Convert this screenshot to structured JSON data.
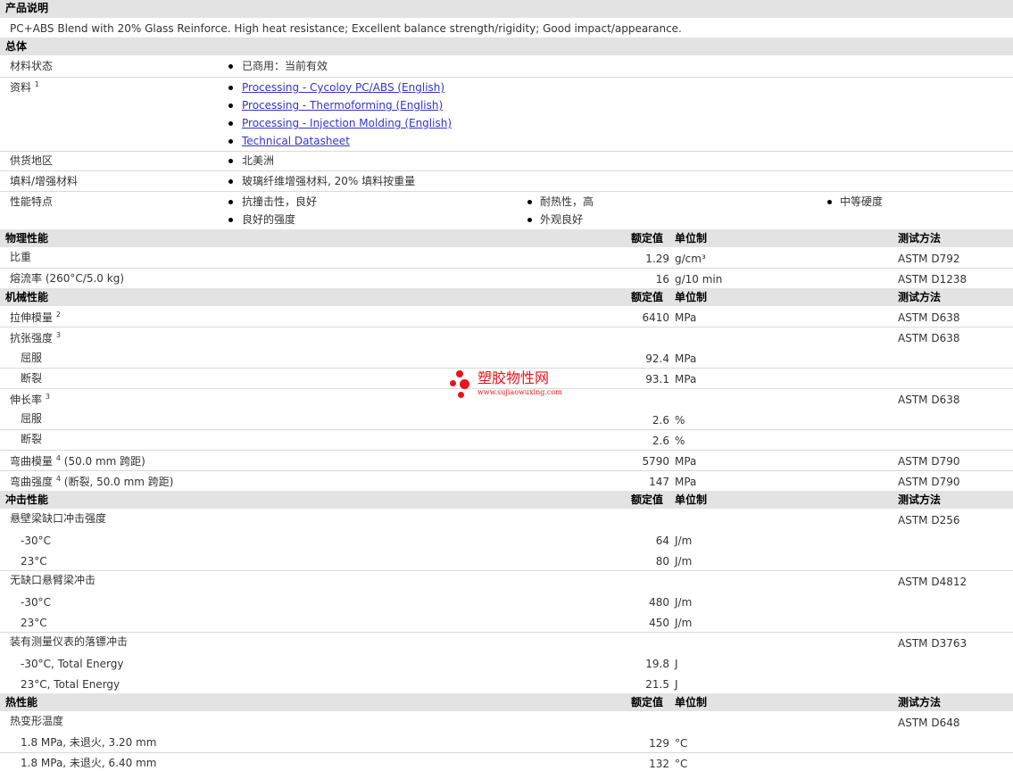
{
  "desc": {
    "header": "产品说明",
    "text": "PC+ABS Blend with 20% Glass Reinforce. High heat resistance; Excellent balance strength/rigidity; Good impact/appearance."
  },
  "general": {
    "header": "总体",
    "status_label": "材料状态",
    "status_value": "已商用：当前有效",
    "docs_label": "资料",
    "docs_sup": "1",
    "docs": [
      "Processing - Cycoloy PC/ABS (English)",
      "Processing - Thermoforming (English)",
      "Processing - Injection Molding (English)",
      "Technical Datasheet"
    ],
    "region_label": "供货地区",
    "region_value": "北美洲",
    "filler_label": "填料/增强材料",
    "filler_value": "玻璃纤维增强材料, 20% 填料按重量",
    "features_label": "性能特点",
    "features": [
      "抗撞击性，良好",
      "耐热性，高",
      "中等硬度",
      "良好的强度",
      "外观良好"
    ]
  },
  "columns": {
    "value": "额定值",
    "unit": "单位制",
    "method": "测试方法"
  },
  "physical": {
    "header": "物理性能",
    "rows": [
      {
        "label": "比重",
        "value": "1.29",
        "unit": "g/cm³",
        "method": "ASTM D792"
      },
      {
        "label": "熔流率",
        "cond": "(260°C/5.0 kg)",
        "value": "16",
        "unit": "g/10 min",
        "method": "ASTM D1238"
      }
    ]
  },
  "mechanical": {
    "header": "机械性能",
    "tensile_modulus": {
      "label": "拉伸模量",
      "sup": "2",
      "value": "6410",
      "unit": "MPa",
      "method": "ASTM D638"
    },
    "tensile_strength": {
      "label": "抗张强度",
      "sup": "3",
      "method": "ASTM D638"
    },
    "ts_yield": {
      "label": "屈服",
      "value": "92.4",
      "unit": "MPa"
    },
    "ts_break": {
      "label": "断裂",
      "value": "93.1",
      "unit": "MPa"
    },
    "elongation": {
      "label": "伸长率",
      "sup": "3",
      "method": "ASTM D638"
    },
    "el_yield": {
      "label": "屈服",
      "value": "2.6",
      "unit": "%"
    },
    "el_break": {
      "label": "断裂",
      "value": "2.6",
      "unit": "%"
    },
    "flex_modulus": {
      "label": "弯曲模量",
      "sup": "4",
      "cond": "(50.0 mm 跨距)",
      "value": "5790",
      "unit": "MPa",
      "method": "ASTM D790"
    },
    "flex_strength": {
      "label": "弯曲强度",
      "sup": "4",
      "cond": "(断裂, 50.0 mm 跨距)",
      "value": "147",
      "unit": "MPa",
      "method": "ASTM D790"
    }
  },
  "impact": {
    "header": "冲击性能",
    "izod": {
      "label": "悬壁梁缺口冲击强度",
      "method": "ASTM D256"
    },
    "izod_m30": {
      "label": "-30°C",
      "value": "64",
      "unit": "J/m"
    },
    "izod_23": {
      "label": "23°C",
      "value": "80",
      "unit": "J/m"
    },
    "unnotched": {
      "label": "无缺口悬臂梁冲击",
      "method": "ASTM D4812"
    },
    "un_m30": {
      "label": "-30°C",
      "value": "480",
      "unit": "J/m"
    },
    "un_23": {
      "label": "23°C",
      "value": "450",
      "unit": "J/m"
    },
    "dart": {
      "label": "装有测量仪表的落镖冲击",
      "method": "ASTM D3763"
    },
    "dart_m30": {
      "label": "-30°C, Total Energy",
      "value": "19.8",
      "unit": "J"
    },
    "dart_23": {
      "label": "23°C, Total Energy",
      "value": "21.5",
      "unit": "J"
    }
  },
  "thermal": {
    "header": "热性能",
    "hdt": {
      "label": "热变形温度",
      "method": "ASTM D648"
    },
    "hdt_1": {
      "label": "1.8 MPa, 未退火, 3.20 mm",
      "value": "129",
      "unit": "°C"
    },
    "hdt_2": {
      "label": "1.8 MPa, 未退火, 6.40 mm",
      "value": "132",
      "unit": "°C"
    }
  },
  "watermark": {
    "name": "塑胶物性网",
    "url": "www.sujiaowuxing.com",
    "color": "#e8141b"
  }
}
